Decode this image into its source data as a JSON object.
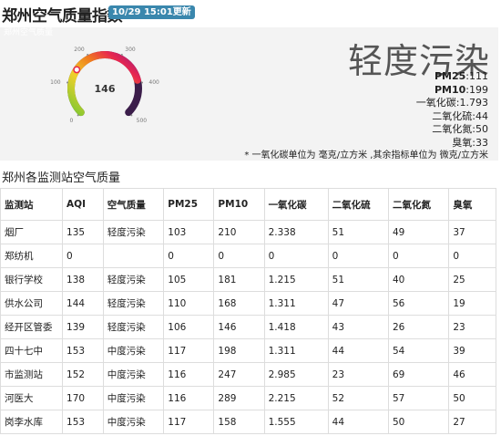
{
  "header": {
    "title": "郑州空气质量指数",
    "updated": "10/29 15:01更新"
  },
  "summary": {
    "panel_label": "郑州空气质量",
    "aqi": "146",
    "gauge_ticks": [
      "0",
      "100",
      "200",
      "300",
      "400",
      "500"
    ],
    "gauge_fraction": 0.292,
    "level": "轻度污染",
    "pollutants": [
      {
        "label": "PM25",
        "value": "111",
        "bold": true
      },
      {
        "label": "PM10",
        "value": "199",
        "bold": true
      },
      {
        "label": "一氧化碳",
        "value": "1.793",
        "bold": false
      },
      {
        "label": "二氧化硫",
        "value": "44",
        "bold": false
      },
      {
        "label": "二氧化氮",
        "value": "50",
        "bold": false
      },
      {
        "label": "臭氧",
        "value": "33",
        "bold": false
      }
    ],
    "note": "* 一氧化碳单位为 毫克/立方米 ,其余指标单位为 微克/立方米"
  },
  "stations": {
    "title": "郑州各监测站空气质量",
    "columns": [
      "监测站",
      "AQI",
      "空气质量",
      "PM25",
      "PM10",
      "一氧化碳",
      "二氧化硫",
      "二氧化氮",
      "臭氧"
    ],
    "rows": [
      [
        "烟厂",
        "135",
        "轻度污染",
        "103",
        "210",
        "2.338",
        "51",
        "49",
        "37"
      ],
      [
        "郑纺机",
        "0",
        "",
        "0",
        "0",
        "0",
        "0",
        "0",
        "0"
      ],
      [
        "银行学校",
        "138",
        "轻度污染",
        "105",
        "181",
        "1.215",
        "51",
        "40",
        "25"
      ],
      [
        "供水公司",
        "144",
        "轻度污染",
        "110",
        "168",
        "1.311",
        "47",
        "56",
        "19"
      ],
      [
        "经开区管委",
        "139",
        "轻度污染",
        "106",
        "146",
        "1.418",
        "43",
        "26",
        "23"
      ],
      [
        "四十七中",
        "153",
        "中度污染",
        "117",
        "198",
        "1.311",
        "44",
        "54",
        "39"
      ],
      [
        "市监测站",
        "152",
        "中度污染",
        "116",
        "247",
        "2.985",
        "23",
        "69",
        "46"
      ],
      [
        "河医大",
        "170",
        "中度污染",
        "116",
        "289",
        "2.215",
        "52",
        "57",
        "50"
      ],
      [
        "岗李水库",
        "153",
        "中度污染",
        "117",
        "158",
        "1.555",
        "44",
        "50",
        "27"
      ]
    ]
  },
  "colors": {
    "badge": "#3a87ad",
    "panel": "#f3f3f3",
    "gauge_track": "#3b1d4a"
  }
}
